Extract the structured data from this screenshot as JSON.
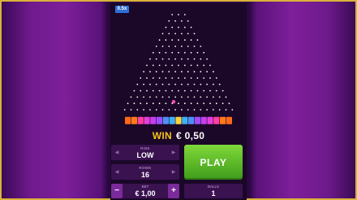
{
  "game": {
    "speed_badge": "0.5x",
    "rows": 16,
    "multipliers": [
      "",
      "",
      "",
      "",
      "",
      "",
      "",
      "",
      "",
      "",
      "",
      "",
      "",
      "",
      "",
      "",
      ""
    ],
    "bucket_colors": [
      "#ff6a1a",
      "#ff7a1a",
      "#ff3fa0",
      "#e43fd8",
      "#c43ff0",
      "#9a4ff5",
      "#4f8ff5",
      "#3fb0f5",
      "#f5d23f",
      "#3fb0f5",
      "#4f8ff5",
      "#9a4ff5",
      "#c43ff0",
      "#e43fd8",
      "#ff3fa0",
      "#ff7a1a",
      "#ff6a1a"
    ],
    "ball_color": "#ff4fb0"
  },
  "win": {
    "label": "WIN",
    "amount": "€ 0,50"
  },
  "controls": {
    "risk": {
      "label": "RISK",
      "value": "LOW"
    },
    "rows": {
      "label": "ROWS",
      "value": "16"
    },
    "bet": {
      "label": "BET",
      "value": "€ 1,00",
      "minus": "−",
      "plus": "+"
    },
    "balls": {
      "label": "BALLS",
      "value": "1"
    },
    "play_label": "PLAY"
  },
  "colors": {
    "accent": "#f5c518",
    "play": "#5fbf2a",
    "frame": "#d9b23a"
  }
}
